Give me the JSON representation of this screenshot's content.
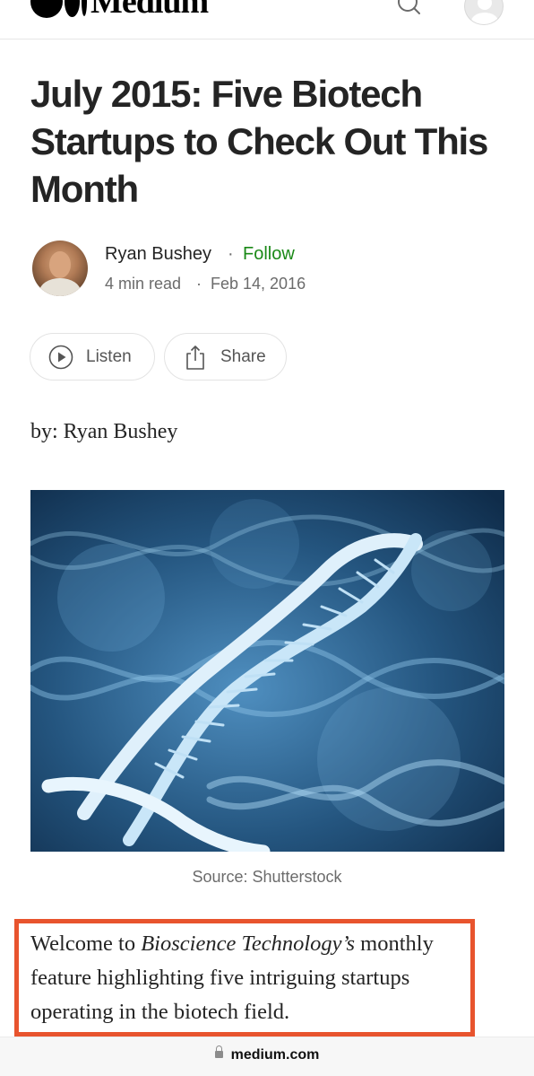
{
  "header": {
    "logo_text": "Medium",
    "search_icon": "search-icon",
    "avatar_icon": "user-avatar-icon"
  },
  "article": {
    "title": "July 2015: Five Biotech Startups to Check Out This Month",
    "author": {
      "name": "Ryan Bushey",
      "separator": "·",
      "follow_label": "Follow",
      "read_time": "4 min read",
      "date": "Feb 14, 2016"
    },
    "actions": {
      "listen_label": "Listen",
      "listen_icon": "play-circle-icon",
      "share_label": "Share",
      "share_icon": "share-icon"
    },
    "byline": "by: Ryan Bushey",
    "hero_image_caption": "Source: Shutterstock",
    "paragraph": {
      "before": "Welcome to ",
      "italic": "Bioscience Technology’s",
      "after": " monthly feature highlighting five intriguing startups operating in the biotech field."
    }
  },
  "browser": {
    "url": "medium.com",
    "lock_icon": "lock-icon"
  },
  "colors": {
    "follow_green": "#1a8917",
    "highlight_border": "#e8542e",
    "text_primary": "#242424",
    "text_secondary": "#6b6b6b"
  }
}
